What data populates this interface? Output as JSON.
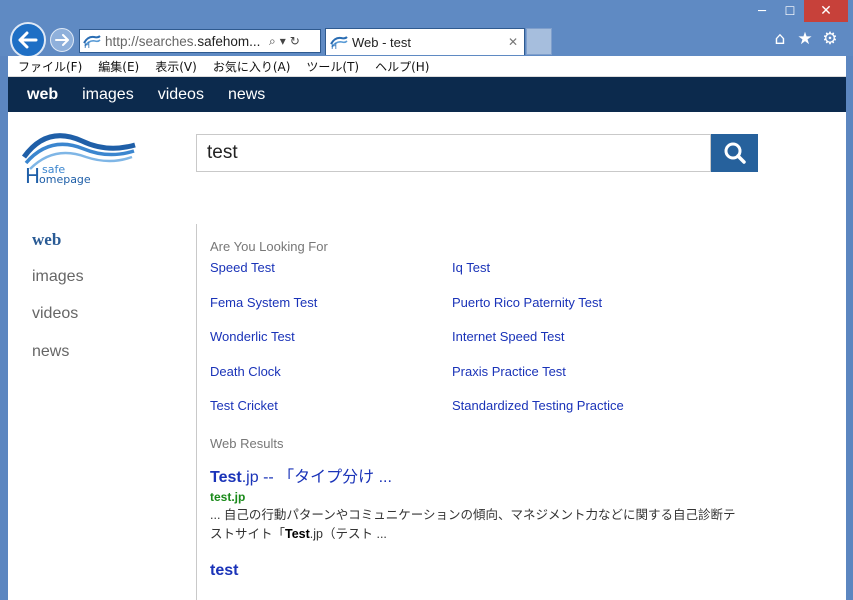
{
  "window": {
    "minimize": "─",
    "maximize": "☐",
    "close": "✕"
  },
  "addressbar": {
    "url_prefix": "http://searches.",
    "url_host": "safehom...",
    "search_icon": "⌕",
    "dropdown_icon": "▾",
    "refresh_icon": "↻"
  },
  "tab": {
    "title": "Web - test",
    "close": "✕"
  },
  "toolbar_icons": {
    "home": "⌂",
    "favorites": "★",
    "tools": "⚙"
  },
  "menubar": {
    "items": [
      "ファイル(F)",
      "編集(E)",
      "表示(V)",
      "お気に入り(A)",
      "ツール(T)",
      "ヘルプ(H)"
    ]
  },
  "topnav": {
    "items": [
      "web",
      "images",
      "videos",
      "news"
    ]
  },
  "logo": {
    "text_safe": "safe",
    "text_h": "H",
    "text_omepage": "omepage"
  },
  "search": {
    "query": "test"
  },
  "sidenav": {
    "items": [
      "web",
      "images",
      "videos",
      "news"
    ]
  },
  "related": {
    "heading": "Are You Looking For",
    "links": [
      "Speed Test",
      "Iq Test",
      "Fema System Test",
      "Puerto Rico Paternity Test",
      "Wonderlic Test",
      "Internet Speed Test",
      "Death Clock",
      "Praxis Practice Test",
      "Test Cricket",
      "Standardized Testing Practice"
    ]
  },
  "web_results": {
    "heading": "Web Results",
    "items": [
      {
        "title_bold": "Test",
        "title_rest": ".jp -- 「タイプ分け ...",
        "url": "test.jp",
        "snippet_1": "... 自己の行動パターンやコミュニケーションの傾向、マネジメント力などに関する自己診断テストサイト「",
        "snippet_bold": "Test",
        "snippet_2": ".jp（テスト ..."
      },
      {
        "title_bold": "test"
      }
    ]
  },
  "colors": {
    "frame": "#5f8ac3",
    "topnav_bg": "#0c2a4d",
    "search_button": "#26619c",
    "link": "#1a33b8",
    "url_green": "#1a8a1a"
  }
}
